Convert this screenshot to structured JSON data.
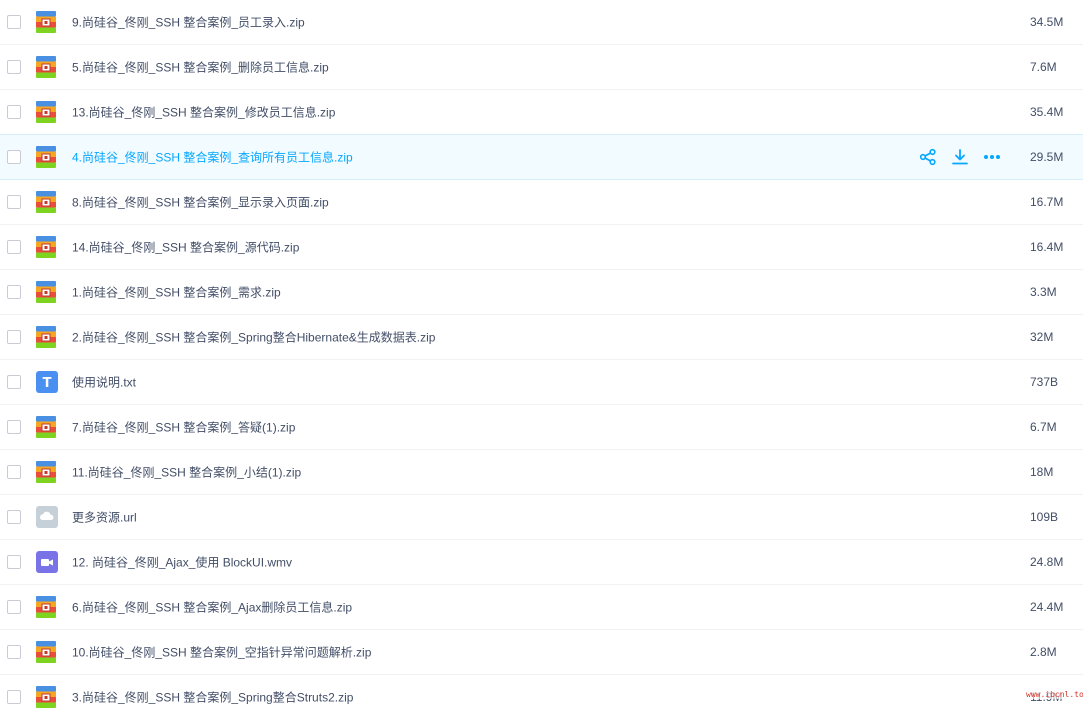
{
  "files": [
    {
      "name": "9.尚硅谷_佟刚_SSH 整合案例_员工录入.zip",
      "size": "34.5M",
      "type": "zip"
    },
    {
      "name": "5.尚硅谷_佟刚_SSH 整合案例_删除员工信息.zip",
      "size": "7.6M",
      "type": "zip"
    },
    {
      "name": "13.尚硅谷_佟刚_SSH 整合案例_修改员工信息.zip",
      "size": "35.4M",
      "type": "zip"
    },
    {
      "name": "4.尚硅谷_佟刚_SSH 整合案例_查询所有员工信息.zip",
      "size": "29.5M",
      "type": "zip",
      "highlighted": true
    },
    {
      "name": "8.尚硅谷_佟刚_SSH 整合案例_显示录入页面.zip",
      "size": "16.7M",
      "type": "zip"
    },
    {
      "name": "14.尚硅谷_佟刚_SSH 整合案例_源代码.zip",
      "size": "16.4M",
      "type": "zip"
    },
    {
      "name": "1.尚硅谷_佟刚_SSH 整合案例_需求.zip",
      "size": "3.3M",
      "type": "zip"
    },
    {
      "name": "2.尚硅谷_佟刚_SSH 整合案例_Spring整合Hibernate&生成数据表.zip",
      "size": "32M",
      "type": "zip"
    },
    {
      "name": "使用说明.txt",
      "size": "737B",
      "type": "txt"
    },
    {
      "name": "7.尚硅谷_佟刚_SSH 整合案例_答疑(1).zip",
      "size": "6.7M",
      "type": "zip"
    },
    {
      "name": "11.尚硅谷_佟刚_SSH 整合案例_小结(1).zip",
      "size": "18M",
      "type": "zip"
    },
    {
      "name": "更多资源.url",
      "size": "109B",
      "type": "url"
    },
    {
      "name": "12. 尚硅谷_佟刚_Ajax_使用 BlockUI.wmv",
      "size": "24.8M",
      "type": "video"
    },
    {
      "name": "6.尚硅谷_佟刚_SSH 整合案例_Ajax删除员工信息.zip",
      "size": "24.4M",
      "type": "zip"
    },
    {
      "name": "10.尚硅谷_佟刚_SSH 整合案例_空指针异常问题解析.zip",
      "size": "2.8M",
      "type": "zip"
    },
    {
      "name": "3.尚硅谷_佟刚_SSH 整合案例_Spring整合Struts2.zip",
      "size": "11.9M",
      "type": "zip"
    }
  ],
  "row_actions": {
    "share_icon": "share-icon",
    "download_icon": "download-icon",
    "more_icon": "more-icon"
  },
  "watermark": "www.ibcnl.top",
  "colors": {
    "text": "#424e67",
    "accent": "#06a7ff",
    "highlight_bg": "#f2fbff",
    "video_icon": "#7a73e8",
    "txt_icon": "#4a90f0",
    "url_icon": "#c5d0d9"
  }
}
